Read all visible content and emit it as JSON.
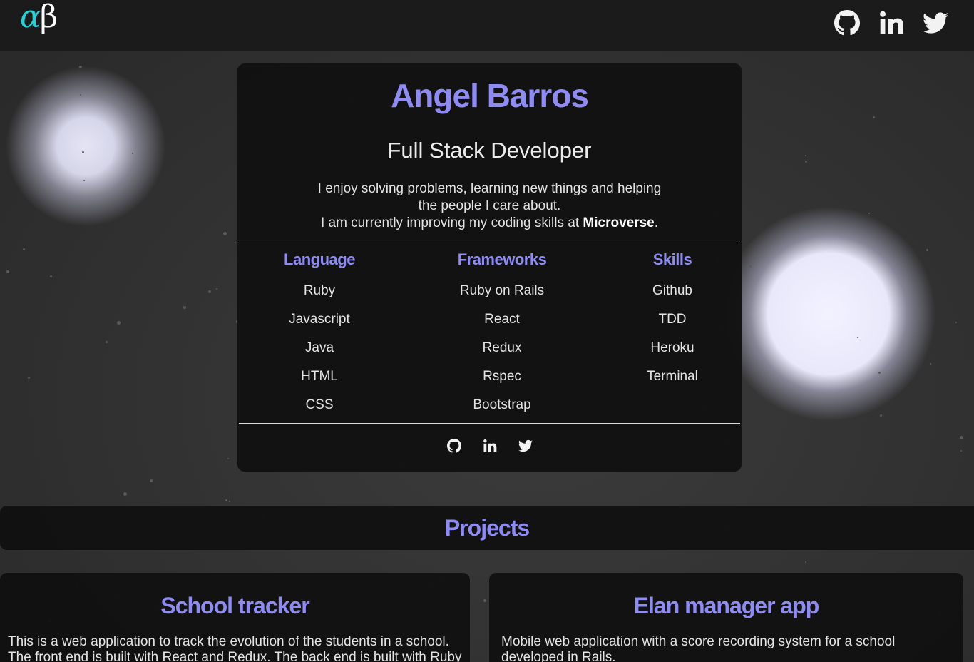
{
  "header": {
    "logo_alpha": "α",
    "logo_beta": "β",
    "social_icons": [
      "github-icon",
      "linkedin-icon",
      "twitter-icon"
    ]
  },
  "intro": {
    "name": "Angel Barros",
    "title": "Full Stack Developer",
    "bio_line1": "I enjoy solving problems, learning new things and helping the people I care about.",
    "bio_line2_prefix": "I am currently improving my coding skills at ",
    "bio_highlight": "Microverse",
    "bio_line2_suffix": "."
  },
  "stack": [
    {
      "heading": "Language",
      "items": [
        "Ruby",
        "Javascript",
        "Java",
        "HTML",
        "CSS"
      ]
    },
    {
      "heading": "Frameworks",
      "items": [
        "Ruby on Rails",
        "React",
        "Redux",
        "Rspec",
        "Bootstrap"
      ]
    },
    {
      "heading": "Skills",
      "items": [
        "Github",
        "TDD",
        "Heroku",
        "Terminal"
      ]
    }
  ],
  "projects": {
    "heading": "Projects",
    "items": [
      {
        "title": "School tracker",
        "description": "This is a web application to track the evolution of the students in a school. The front end is built with React and Redux. The back end is built with Ruby on"
      },
      {
        "title": "Elan manager app",
        "description": "Mobile web application with a score recording system for a school developed in Rails."
      }
    ]
  },
  "colors": {
    "accent": "#8f8bf4",
    "panel": "#111111",
    "topbar": "#1b1b1b",
    "logo_alpha": "#22d3d8"
  }
}
